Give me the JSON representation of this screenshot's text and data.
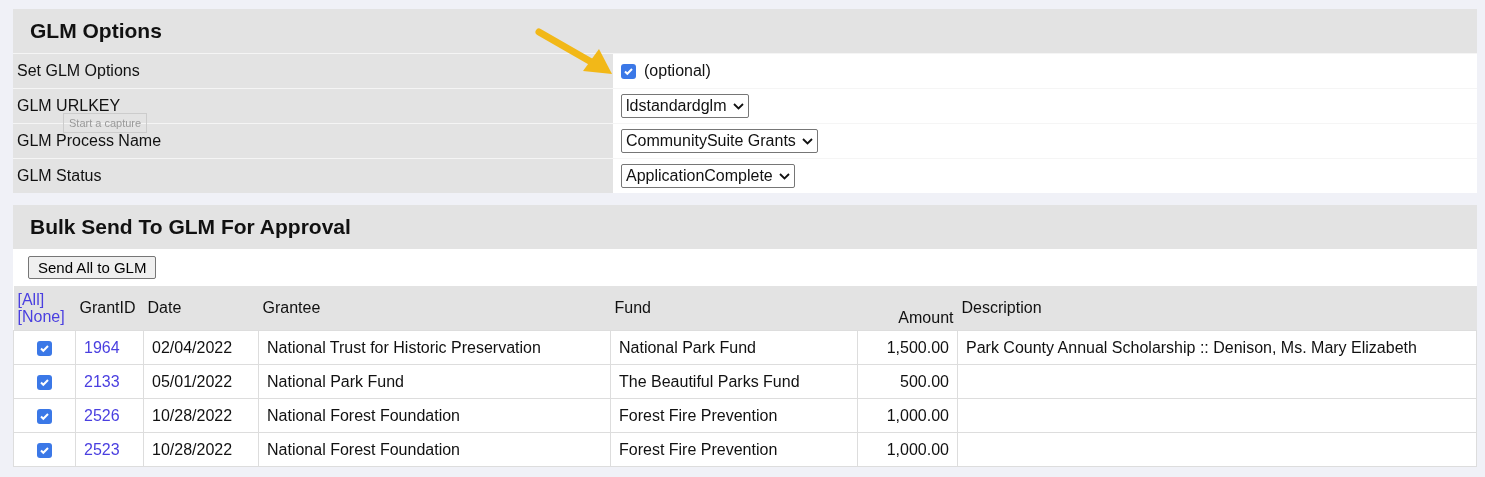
{
  "options": {
    "title": "GLM Options",
    "rows": [
      {
        "kind": "checkbox",
        "label": "Set GLM Options",
        "checked": true,
        "note": "(optional)"
      },
      {
        "kind": "select",
        "label": "GLM URLKEY",
        "value": "ldstandardglm"
      },
      {
        "kind": "select",
        "label": "GLM Process Name",
        "value": "CommunitySuite Grants"
      },
      {
        "kind": "select",
        "label": "GLM Status",
        "value": "ApplicationComplete"
      }
    ]
  },
  "tooltip": "Start a capture",
  "bulk": {
    "title": "Bulk Send To GLM For Approval",
    "button": "Send All to GLM",
    "select_all": "[All]",
    "select_none": "[None]",
    "columns": [
      "GrantID",
      "Date",
      "Grantee",
      "Fund",
      "Amount",
      "Description"
    ],
    "rows": [
      {
        "checked": true,
        "grant_id": "1964",
        "date": "02/04/2022",
        "grantee": "National Trust for Historic Preservation",
        "fund": "National Park Fund",
        "amount": "1,500.00",
        "description": "Park County Annual Scholarship :: Denison, Ms. Mary Elizabeth"
      },
      {
        "checked": true,
        "grant_id": "2133",
        "date": "05/01/2022",
        "grantee": "National Park Fund",
        "fund": "The Beautiful Parks Fund",
        "amount": "500.00"
      },
      {
        "checked": true,
        "grant_id": "2526",
        "date": "10/28/2022",
        "grantee": "National Forest Foundation",
        "fund": "Forest Fire Prevention",
        "amount": "1,000.00"
      },
      {
        "checked": true,
        "grant_id": "2523",
        "date": "10/28/2022",
        "grantee": "National Forest Foundation",
        "fund": "Forest Fire Prevention",
        "amount": "1,000.00"
      }
    ]
  }
}
